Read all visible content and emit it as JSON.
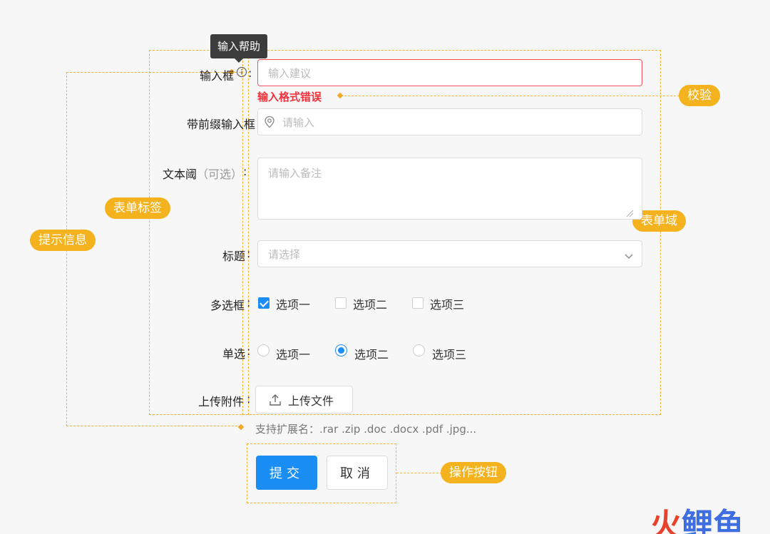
{
  "tooltip": "输入帮助",
  "annotations": {
    "validation": "校验",
    "form_label": "表单标签",
    "hint_info": "提示信息",
    "form_field": "表单域",
    "action_buttons": "操作按钮"
  },
  "fields": {
    "input": {
      "label": "输入框",
      "placeholder": "输入建议",
      "error": "输入格式错误",
      "info_icon": "info-circle-icon"
    },
    "prefix_input": {
      "label": "带前缀输入框",
      "placeholder": "请输入",
      "icon": "location-pin-icon"
    },
    "textarea": {
      "label": "文本阈",
      "label_optional": "（可选）",
      "placeholder": "请输入备注"
    },
    "select": {
      "label": "标题",
      "placeholder": "请选择",
      "icon": "chevron-down-icon"
    },
    "checkbox": {
      "label": "多选框",
      "options": [
        {
          "label": "选项一",
          "checked": true
        },
        {
          "label": "选项二",
          "checked": false
        },
        {
          "label": "选项三",
          "checked": false
        }
      ]
    },
    "radio": {
      "label": "单选",
      "options": [
        {
          "label": "选项一",
          "checked": false
        },
        {
          "label": "选项二",
          "checked": true
        },
        {
          "label": "选项三",
          "checked": false
        }
      ]
    },
    "upload": {
      "label": "上传附件",
      "button": "上传文件",
      "icon": "upload-icon",
      "hint": "支持扩展名：.rar .zip .doc .docx .pdf .jpg..."
    }
  },
  "actions": {
    "submit": "提交",
    "cancel": "取消"
  },
  "watermark": {
    "part1": "火",
    "part2": "鲤鱼"
  },
  "colors": {
    "primary": "#1b8ef5",
    "error": "#f0323c",
    "annotation": "#f5b21f"
  }
}
